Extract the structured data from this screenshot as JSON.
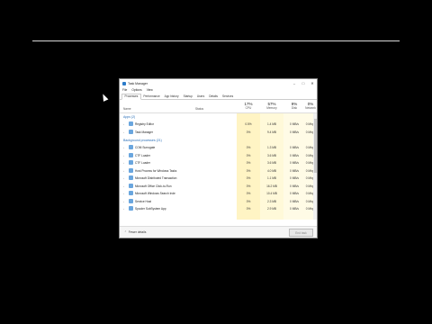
{
  "window": {
    "title": "Task Manager",
    "buttons": [
      "–",
      "□",
      "✕"
    ]
  },
  "menu": [
    "File",
    "Options",
    "View"
  ],
  "tabs": [
    "Processes",
    "Performance",
    "App history",
    "Startup",
    "Users",
    "Details",
    "Services"
  ],
  "header": {
    "name": "Name",
    "status": "Status",
    "cpu": {
      "pct": "17%",
      "label": "CPU"
    },
    "memory": {
      "pct": "57%",
      "label": "Memory"
    },
    "disk": {
      "pct": "9%",
      "label": "Disk"
    },
    "network": {
      "pct": "0%",
      "label": "Network"
    }
  },
  "groups": {
    "apps": "Apps (2)",
    "background": "Background processes (21)"
  },
  "apps": [
    {
      "name": "Registry Editor",
      "cpu": "0.5%",
      "memory": "1.4 MB",
      "disk": "0 MB/s",
      "network": "0 Mbps"
    },
    {
      "name": "Task Manager",
      "cpu": "0%",
      "memory": "9.4 MB",
      "disk": "0 MB/s",
      "network": "0 Mbps"
    }
  ],
  "background": [
    {
      "name": "COM Surrogate",
      "cpu": "0%",
      "memory": "1.3 MB",
      "disk": "0 MB/s",
      "network": "0 Mbps"
    },
    {
      "name": "CTF Loader",
      "cpu": "0%",
      "memory": "3.6 MB",
      "disk": "0 MB/s",
      "network": "0 Mbps"
    },
    {
      "name": "CTF Loader",
      "cpu": "0%",
      "memory": "3.6 MB",
      "disk": "0 MB/s",
      "network": "0 Mbps"
    },
    {
      "name": "Host Process for Windows Tasks",
      "cpu": "0%",
      "memory": "4.0 MB",
      "disk": "0 MB/s",
      "network": "0 Mbps"
    },
    {
      "name": "Microsoft Distributed Transaction",
      "cpu": "0%",
      "memory": "1.1 MB",
      "disk": "0 MB/s",
      "network": "0 Mbps"
    },
    {
      "name": "Microsoft Office Click-to-Run",
      "cpu": "0%",
      "memory": "16.2 MB",
      "disk": "0 MB/s",
      "network": "0 Mbps"
    },
    {
      "name": "Microsoft Windows Search Inde",
      "cpu": "0%",
      "memory": "10.4 MB",
      "disk": "0 MB/s",
      "network": "0 Mbps"
    },
    {
      "name": "Service Host",
      "cpu": "0%",
      "memory": "2.3 MB",
      "disk": "0 MB/s",
      "network": "0 Mbps"
    },
    {
      "name": "Spooler SubSystem App",
      "cpu": "0%",
      "memory": "2.9 MB",
      "disk": "0 MB/s",
      "network": "0 Mbps"
    }
  ],
  "footer": {
    "fewer": "Fewer details",
    "end_task": "End task"
  }
}
